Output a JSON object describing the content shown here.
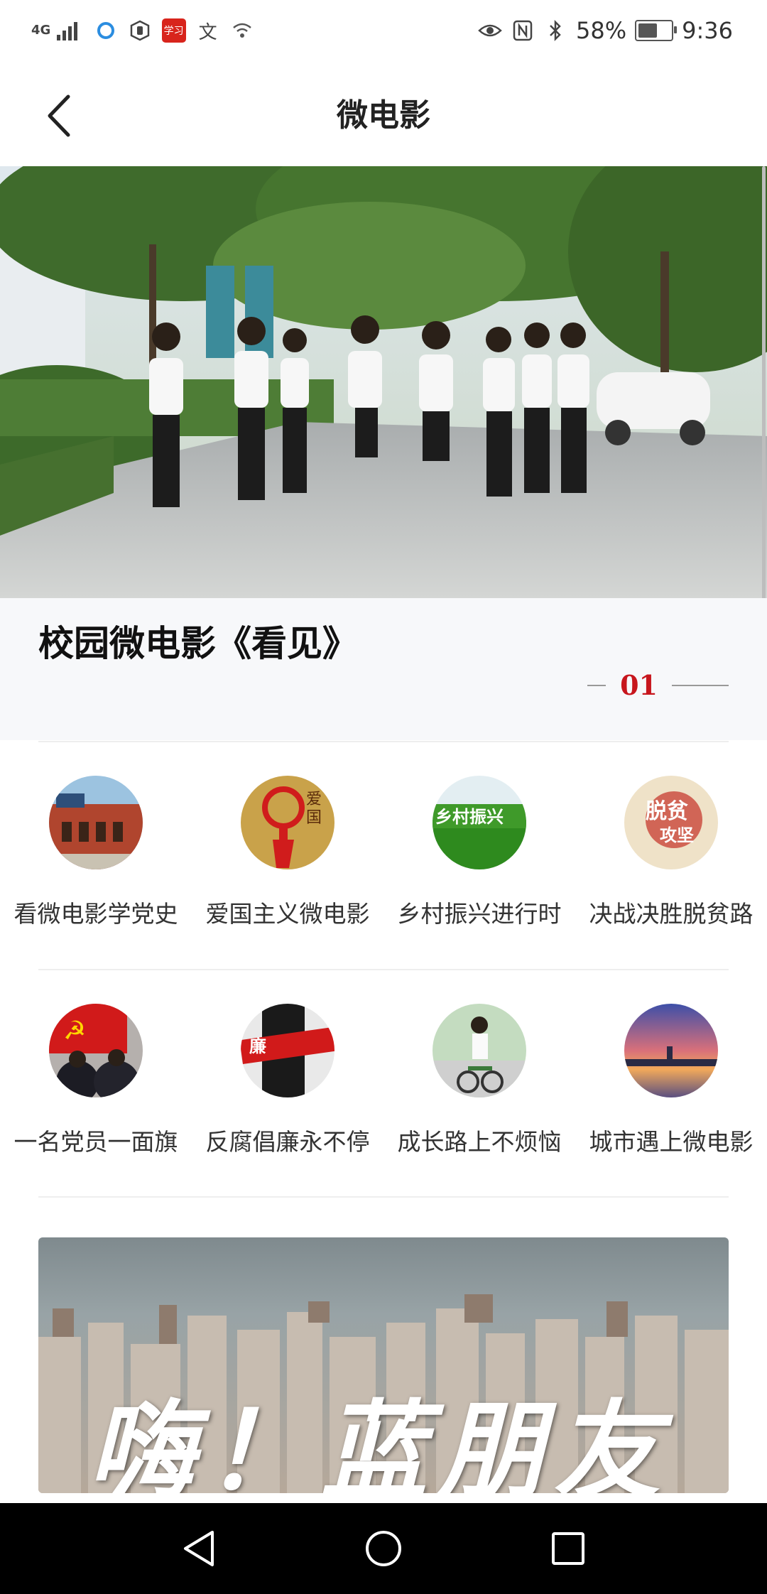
{
  "status_bar": {
    "network": "4G",
    "battery_percent": "58%",
    "battery_level": 0.58,
    "time": "9:36",
    "app_badge": "学习"
  },
  "header": {
    "title": "微电影",
    "back_icon": "chevron-left-icon"
  },
  "banner": {
    "title": "校园微电影《看见》",
    "index": "01"
  },
  "categories": [
    {
      "label": "看微电影学党史",
      "icon": "red-brick-building-icon"
    },
    {
      "label": "爱国主义微电影",
      "icon": "chinese-knot-icon"
    },
    {
      "label": "乡村振兴进行时",
      "icon": "green-field-icon"
    },
    {
      "label": "决战决胜脱贫路",
      "icon": "poverty-calligraphy-icon"
    },
    {
      "label": "一名党员一面旗",
      "icon": "party-flag-icon"
    },
    {
      "label": "反腐倡廉永不停",
      "icon": "anti-corruption-icon"
    },
    {
      "label": "成长路上不烦恼",
      "icon": "girl-bicycle-icon"
    },
    {
      "label": "城市遇上微电影",
      "icon": "city-sunset-icon"
    }
  ],
  "promo": {
    "text": "嗨！蓝朋友"
  },
  "nav": {
    "back": "triangle-back-icon",
    "home": "circle-home-icon",
    "recents": "square-recents-icon"
  }
}
